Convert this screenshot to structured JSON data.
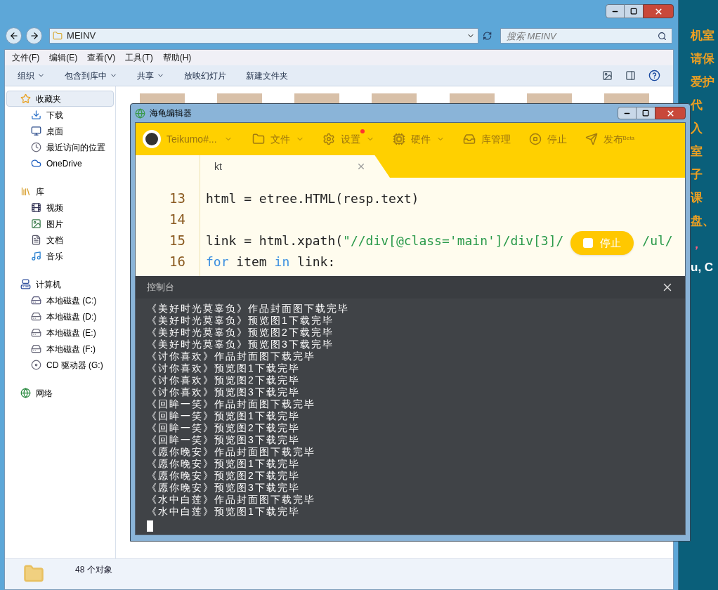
{
  "explorer": {
    "address": "MEINV",
    "search": {
      "placeholder": "搜索 MEINV"
    },
    "menu": [
      "文件(F)",
      "编辑(E)",
      "查看(V)",
      "工具(T)",
      "帮助(H)"
    ],
    "commands": [
      {
        "label": "组织",
        "dropdown": true
      },
      {
        "label": "包含到库中",
        "dropdown": true
      },
      {
        "label": "共享",
        "dropdown": true
      },
      {
        "label": "放映幻灯片",
        "dropdown": false
      },
      {
        "label": "新建文件夹",
        "dropdown": false
      }
    ],
    "sidebar": [
      {
        "label": "收藏夹",
        "kind": "favorites",
        "selected": true,
        "children": [
          {
            "label": "下载",
            "kind": "downloads"
          },
          {
            "label": "桌面",
            "kind": "desktop"
          },
          {
            "label": "最近访问的位置",
            "kind": "recent"
          },
          {
            "label": "OneDrive",
            "kind": "cloud"
          }
        ]
      },
      {
        "label": "库",
        "kind": "library",
        "selected": false,
        "children": [
          {
            "label": "视频",
            "kind": "video"
          },
          {
            "label": "图片",
            "kind": "pictures"
          },
          {
            "label": "文档",
            "kind": "docs"
          },
          {
            "label": "音乐",
            "kind": "music"
          }
        ]
      },
      {
        "label": "计算机",
        "kind": "computer",
        "selected": false,
        "children": [
          {
            "label": "本地磁盘 (C:)",
            "kind": "system-drive"
          },
          {
            "label": "本地磁盘 (D:)",
            "kind": "drive"
          },
          {
            "label": "本地磁盘 (E:)",
            "kind": "drive"
          },
          {
            "label": "本地磁盘 (F:)",
            "kind": "drive"
          },
          {
            "label": "CD 驱动器 (G:)",
            "kind": "cd"
          }
        ]
      },
      {
        "label": "网络",
        "kind": "network",
        "selected": false
      }
    ],
    "status": "48 个对象"
  },
  "desktop_text": [
    {
      "text": "机室",
      "color": "#f0a020"
    },
    {
      "text": "请保",
      "color": "#f0a020"
    },
    {
      "text": "爱护",
      "color": "#f0a020"
    },
    {
      "text": "代",
      "color": "#f0a020"
    },
    {
      "text": "入",
      "color": "#f0a020"
    },
    {
      "text": "室",
      "color": "#f0a020"
    },
    {
      "text": "子",
      "color": "#f0a020"
    },
    {
      "text": "课",
      "color": "#f0a020"
    },
    {
      "text": "盘、",
      "color": "#f0a020"
    },
    {
      "text": "，",
      "color": "#ff6080"
    },
    {
      "text": "u, C",
      "color": "#ffffff"
    }
  ],
  "editor": {
    "title": "海龟编辑器",
    "user": "Teikumo#...",
    "toolbar": [
      {
        "label": "文件",
        "kind": "folder",
        "dropdown": true,
        "notification": false
      },
      {
        "label": "设置",
        "kind": "gear",
        "dropdown": true,
        "notification": true
      },
      {
        "label": "硬件",
        "kind": "hardware",
        "dropdown": true,
        "notification": false
      },
      {
        "label": "库管理",
        "kind": "inbox",
        "dropdown": false,
        "notification": false
      },
      {
        "label": "停止",
        "kind": "stop",
        "dropdown": false,
        "notification": false
      },
      {
        "label": "发布$^{Beta}$",
        "kind": "send",
        "dropdown": false,
        "notification": false
      }
    ],
    "tab": {
      "label": "kt",
      "selected": true
    },
    "code": [
      {
        "number": "13",
        "tokens": [
          {
            "kind": "plain",
            "text": "html = etree.HTML(resp.text)"
          }
        ]
      },
      {
        "number": "14"
      },
      {
        "number": "15",
        "tokens": [
          {
            "kind": "plain",
            "text": "link = html.xpath("
          },
          {
            "kind": "string",
            "text": "\"//div[@class='main']/div[3]/"
          },
          {
            "kind": "hidden"
          },
          {
            "kind": "string",
            "text": "/ul/"
          }
        ]
      },
      {
        "number": "16",
        "tokens": [
          {
            "kind": "keyword",
            "text": "for"
          },
          {
            "kind": "plain",
            "text": " item "
          },
          {
            "kind": "keyword",
            "text": "in"
          },
          {
            "kind": "plain",
            "text": " link:"
          }
        ]
      }
    ],
    "run_button": "停止",
    "console": {
      "title": "控制台",
      "cursor": true,
      "lines": [
        "《美好时光莫辜负》作品封面图下载完毕",
        "《美好时光莫辜负》预览图1下载完毕",
        "《美好时光莫辜负》预览图2下载完毕",
        "《美好时光莫辜负》预览图3下载完毕",
        "《讨你喜欢》作品封面图下载完毕",
        "《讨你喜欢》预览图1下载完毕",
        "《讨你喜欢》预览图2下载完毕",
        "《讨你喜欢》预览图3下载完毕",
        "《回眸一笑》作品封面图下载完毕",
        "《回眸一笑》预览图1下载完毕",
        "《回眸一笑》预览图2下载完毕",
        "《回眸一笑》预览图3下载完毕",
        "《愿你晚安》作品封面图下载完毕",
        "《愿你晚安》预览图1下载完毕",
        "《愿你晚安》预览图2下载完毕",
        "《愿你晚安》预览图3下载完毕",
        "《水中白莲》作品封面图下载完毕",
        "《水中白莲》预览图1下载完毕"
      ]
    }
  }
}
